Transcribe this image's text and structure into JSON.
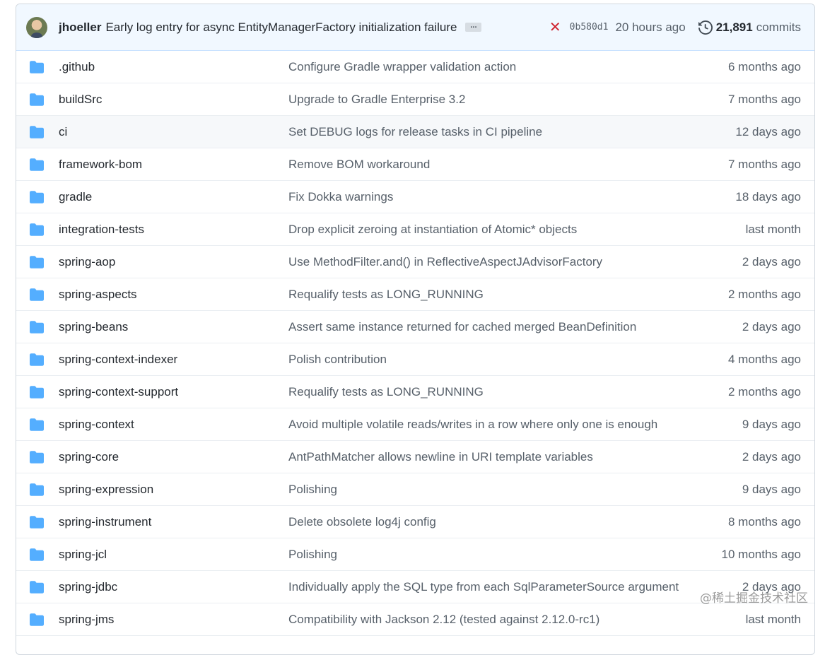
{
  "commit": {
    "author": "jhoeller",
    "message": "Early log entry for async EntityManagerFactory initialization failure",
    "ellipsis": "...",
    "status_icon": "x-icon",
    "sha": "0b580d1",
    "time": "20 hours ago",
    "count": "21,891",
    "commits_label": "commits"
  },
  "colors": {
    "folder": "#54aeff",
    "status_fail": "#cf222e",
    "header_bg": "#f1f8ff"
  },
  "files": [
    {
      "name": ".github",
      "message": "Configure Gradle wrapper validation action",
      "age": "6 months ago"
    },
    {
      "name": "buildSrc",
      "message": "Upgrade to Gradle Enterprise 3.2",
      "age": "7 months ago"
    },
    {
      "name": "ci",
      "message": "Set DEBUG logs for release tasks in CI pipeline",
      "age": "12 days ago"
    },
    {
      "name": "framework-bom",
      "message": "Remove BOM workaround",
      "age": "7 months ago"
    },
    {
      "name": "gradle",
      "message": "Fix Dokka warnings",
      "age": "18 days ago"
    },
    {
      "name": "integration-tests",
      "message": "Drop explicit zeroing at instantiation of Atomic* objects",
      "age": "last month"
    },
    {
      "name": "spring-aop",
      "message": "Use MethodFilter.and() in ReflectiveAspectJAdvisorFactory",
      "age": "2 days ago"
    },
    {
      "name": "spring-aspects",
      "message": "Requalify tests as LONG_RUNNING",
      "age": "2 months ago"
    },
    {
      "name": "spring-beans",
      "message": "Assert same instance returned for cached merged BeanDefinition",
      "age": "2 days ago"
    },
    {
      "name": "spring-context-indexer",
      "message": "Polish contribution",
      "age": "4 months ago"
    },
    {
      "name": "spring-context-support",
      "message": "Requalify tests as LONG_RUNNING",
      "age": "2 months ago"
    },
    {
      "name": "spring-context",
      "message": "Avoid multiple volatile reads/writes in a row where only one is enough",
      "age": "9 days ago"
    },
    {
      "name": "spring-core",
      "message": "AntPathMatcher allows newline in URI template variables",
      "age": "2 days ago"
    },
    {
      "name": "spring-expression",
      "message": "Polishing",
      "age": "9 days ago"
    },
    {
      "name": "spring-instrument",
      "message": "Delete obsolete log4j config",
      "age": "8 months ago"
    },
    {
      "name": "spring-jcl",
      "message": "Polishing",
      "age": "10 months ago"
    },
    {
      "name": "spring-jdbc",
      "message": "Individually apply the SQL type from each SqlParameterSource argument",
      "age": "2 days ago"
    },
    {
      "name": "spring-jms",
      "message": "Compatibility with Jackson 2.12 (tested against 2.12.0-rc1)",
      "age": "last month"
    }
  ],
  "highlighted_row": "ci",
  "watermark": "@稀土掘金技术社区"
}
